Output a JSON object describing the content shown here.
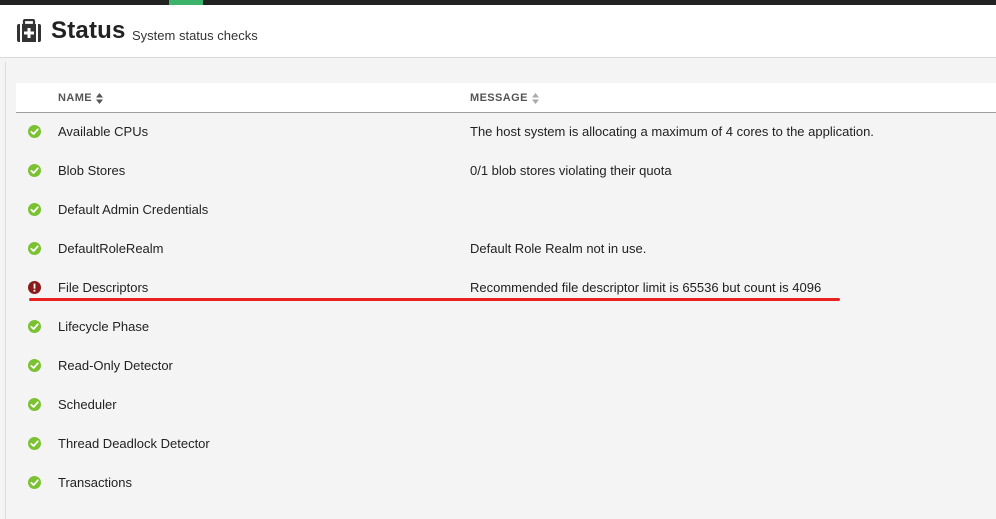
{
  "header": {
    "title": "Status",
    "subtitle": "System status checks",
    "icon": "first-aid-kit-icon"
  },
  "table": {
    "columns": [
      {
        "label": "NAME",
        "sortable": true
      },
      {
        "label": "MESSAGE",
        "sortable": true
      }
    ],
    "rows": [
      {
        "status": "ok",
        "name": "Available CPUs",
        "message": "The host system is allocating a maximum of 4 cores to the application."
      },
      {
        "status": "ok",
        "name": "Blob Stores",
        "message": "0/1 blob stores violating their quota"
      },
      {
        "status": "ok",
        "name": "Default Admin Credentials",
        "message": ""
      },
      {
        "status": "ok",
        "name": "DefaultRoleRealm",
        "message": "Default Role Realm not in use."
      },
      {
        "status": "error",
        "name": "File Descriptors",
        "message": "Recommended file descriptor limit is 65536 but count is 4096"
      },
      {
        "status": "ok",
        "name": "Lifecycle Phase",
        "message": ""
      },
      {
        "status": "ok",
        "name": "Read-Only Detector",
        "message": ""
      },
      {
        "status": "ok",
        "name": "Scheduler",
        "message": ""
      },
      {
        "status": "ok",
        "name": "Thread Deadlock Detector",
        "message": ""
      },
      {
        "status": "ok",
        "name": "Transactions",
        "message": ""
      }
    ]
  },
  "colors": {
    "ok": "#7ac231",
    "error": "#8b1a1a",
    "annotation": "#e8211e",
    "active_tab": "#3bb36a"
  }
}
